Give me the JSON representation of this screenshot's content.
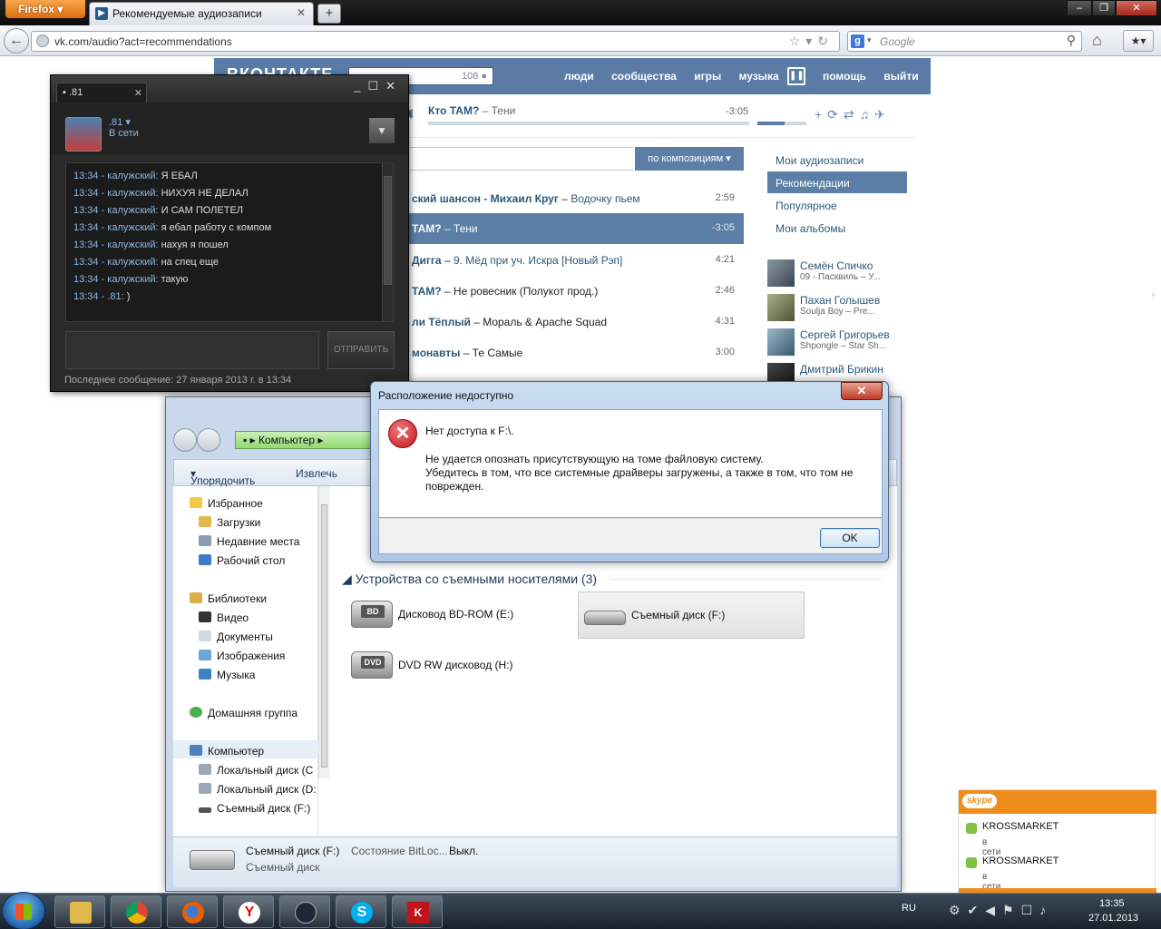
{
  "browser": {
    "menu_label": "Firefox",
    "tab_title": "Рекомендуемые аудиозаписи",
    "url": "vk.com/audio?act=recommendations",
    "search_placeholder": "Google"
  },
  "vk": {
    "search_count": "108",
    "nav": [
      "люди",
      "сообщества",
      "игры",
      "музыка",
      "помощь",
      "выйти"
    ],
    "player": {
      "artist": "Кто ТАМ?",
      "title": "Тени",
      "time": "-3:05"
    },
    "search_sort": "по композициям",
    "tracks": [
      {
        "artist": "ский шансон - Михаил Круг",
        "title": "Водочку пьем",
        "duration": "2:59"
      },
      {
        "artist": "ТАМ?",
        "title": "Тени",
        "duration": "-3:05"
      },
      {
        "artist": "Дигга",
        "title": "9. Мёд при уч. Искра [Новый Рэп]",
        "duration": "4:21"
      },
      {
        "artist": "ТАМ?",
        "title": "Не ровесник (Полукот прод.)",
        "duration": "2:46"
      },
      {
        "artist": "ли Тёплый",
        "title": "Мораль & Apache Squad",
        "duration": "4:31"
      },
      {
        "artist": "монавты",
        "title": "Те Самые",
        "duration": "3:00"
      }
    ],
    "side_menu": [
      "Мои аудиозаписи",
      "Рекомендации",
      "Популярное",
      "Мои альбомы"
    ],
    "friends": [
      {
        "name": "Семён Спичко",
        "sub": "09 - Пасквиль – У..."
      },
      {
        "name": "Пахан Голышев",
        "sub": "Soulja Boy – Pre..."
      },
      {
        "name": "Сергей Григорьев",
        "sub": "Shpongle – Star Sh..."
      },
      {
        "name": "Дмитрий Брикин",
        "sub": ""
      }
    ]
  },
  "chat": {
    "tab_label": ".81",
    "nick": ".81",
    "status": "В сети",
    "messages": [
      {
        "ts": "13:34 - калужский:",
        "text": "Я ЕБАЛ"
      },
      {
        "ts": "13:34 - калужский:",
        "text": "НИХУЯ НЕ ДЕЛАЛ"
      },
      {
        "ts": "13:34 - калужский:",
        "text": "И САМ ПОЛЕТЕЛ"
      },
      {
        "ts": "13:34 - калужский:",
        "text": "я ебал работу с компом"
      },
      {
        "ts": "13:34 - калужский:",
        "text": "нахуя я пошел"
      },
      {
        "ts": "13:34 - калужский:",
        "text": "на спец еще"
      },
      {
        "ts": "13:34 - калужский:",
        "text": "такую"
      },
      {
        "ts": "13:34 - .81:",
        "text": ")"
      }
    ],
    "send_label": "ОТПРАВИТЬ",
    "last_message": "Последнее сообщение: 27 января 2013 г. в 13:34"
  },
  "explorer": {
    "address": "Компьютер",
    "toolbar": [
      "Упорядочить",
      "Извлечь"
    ],
    "nav": {
      "favorites": "Избранное",
      "downloads": "Загрузки",
      "recent": "Недавние места",
      "desktop": "Рабочий стол",
      "libraries": "Библиотеки",
      "video": "Видео",
      "documents": "Документы",
      "images": "Изображения",
      "music": "Музыка",
      "homegroup": "Домашняя группа",
      "computer": "Компьютер",
      "local_c": "Локальный диск (C",
      "local_d": "Локальный диск (D:",
      "removable_f": "Съемный диск (F:)"
    },
    "group_removable": "Устройства со съемными носителями (3)",
    "drives": [
      {
        "label": "Дисковод BD-ROM (E:)",
        "badge": "BD"
      },
      {
        "label": "Съемный диск (F:)",
        "badge": ""
      },
      {
        "label": "DVD RW дисковод (H:)",
        "badge": "DVD"
      }
    ],
    "details": {
      "name": "Съемный диск (F:)",
      "bitlocker": "Состояние BitLoc...",
      "bitlocker_value": "Выкл.",
      "type": "Съемный диск"
    }
  },
  "dialog": {
    "title": "Расположение недоступно",
    "line1": "Нет доступа к F:\\.",
    "line2": "Не удается опознать присутствующую на томе файловую систему.",
    "line3": "Убедитесь в том, что все системные драйверы загружены, а также в том, что том не поврежден.",
    "ok_label": "OK"
  },
  "skype": {
    "logo": "skype",
    "contacts": [
      {
        "name": "KROSSMARKET",
        "status": "в сети"
      },
      {
        "name": "KROSSMARKET",
        "status": "в сети"
      }
    ]
  },
  "taskbar": {
    "lang": "RU",
    "time": "13:35",
    "date": "27.01.2013"
  },
  "colors": {
    "vk_blue": "#597ba5",
    "firefox_orange": "#e66000",
    "skype_orange": "#f08c1c",
    "error_red": "#c0141a"
  }
}
